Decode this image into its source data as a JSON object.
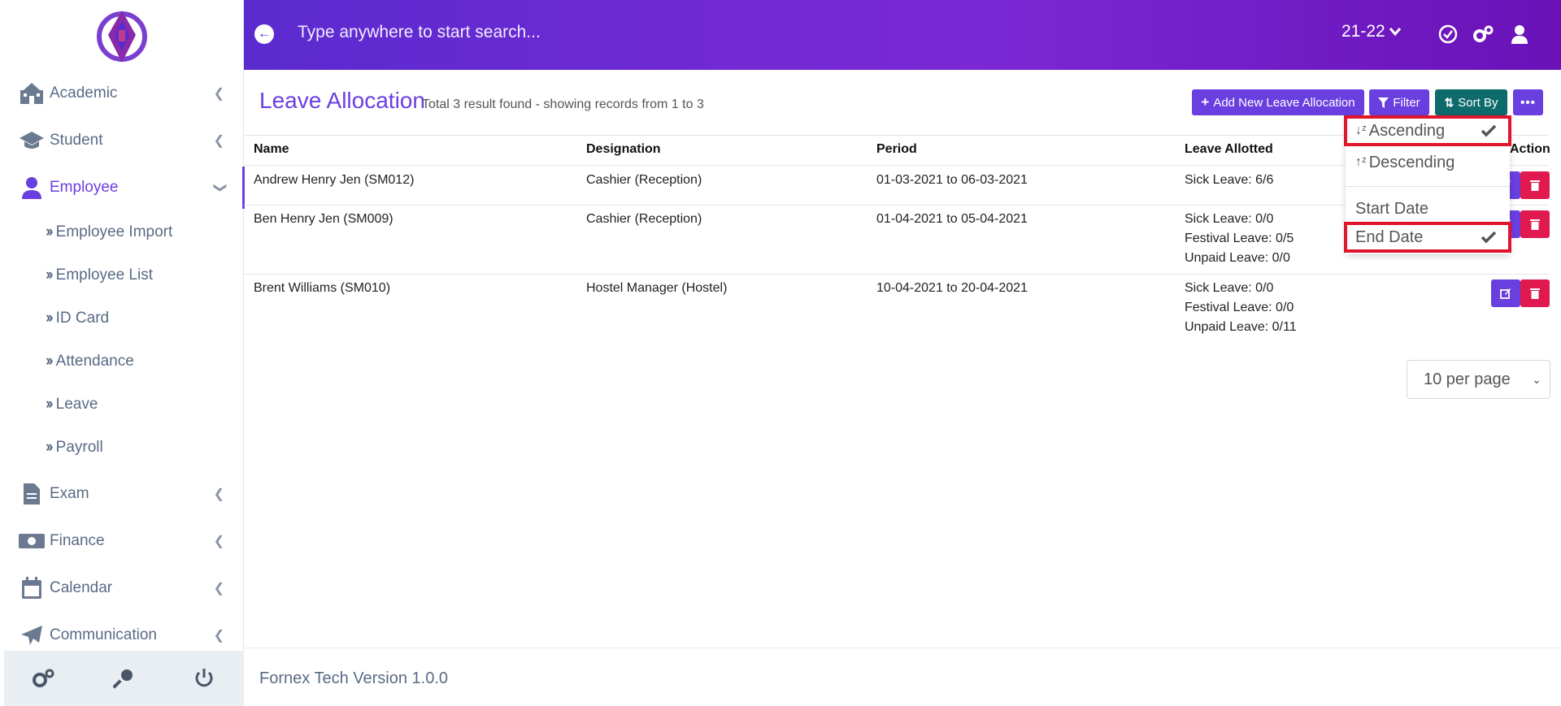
{
  "header": {
    "search_placeholder": "Type anywhere to start search...",
    "year": "21-22"
  },
  "sidebar": {
    "items": [
      {
        "label": "Academic"
      },
      {
        "label": "Student"
      },
      {
        "label": "Employee"
      },
      {
        "label": "Exam"
      },
      {
        "label": "Finance"
      },
      {
        "label": "Calendar"
      },
      {
        "label": "Communication"
      }
    ],
    "employee_sub": [
      {
        "label": "Employee Import"
      },
      {
        "label": "Employee List"
      },
      {
        "label": "ID Card"
      },
      {
        "label": "Attendance"
      },
      {
        "label": "Leave"
      },
      {
        "label": "Payroll"
      }
    ]
  },
  "page": {
    "title": "Leave Allocation",
    "result_text": "Total 3 result found - showing records from 1 to 3",
    "add_button": "Add New Leave Allocation",
    "filter_button": "Filter",
    "sort_button": "Sort By"
  },
  "table": {
    "headers": [
      "Name",
      "Designation",
      "Period",
      "Leave Allotted",
      "Action"
    ],
    "rows": [
      {
        "name": "Andrew Henry Jen (SM012)",
        "designation": "Cashier (Reception)",
        "period": "01-03-2021 to 06-03-2021",
        "leaves": [
          "Sick Leave: 6/6"
        ]
      },
      {
        "name": "Ben Henry Jen (SM009)",
        "designation": "Cashier (Reception)",
        "period": "01-04-2021 to 05-04-2021",
        "leaves": [
          "Sick Leave: 0/0",
          "Festival Leave: 0/5",
          "Unpaid Leave: 0/0"
        ]
      },
      {
        "name": "Brent Williams (SM010)",
        "designation": "Hostel Manager (Hostel)",
        "period": "10-04-2021 to 20-04-2021",
        "leaves": [
          "Sick Leave: 0/0",
          "Festival Leave: 0/0",
          "Unpaid Leave: 0/11"
        ]
      }
    ]
  },
  "pagination": {
    "per_page": "10 per page"
  },
  "sort_menu": {
    "ascending": "Ascending",
    "descending": "Descending",
    "start_date": "Start Date",
    "end_date": "End Date"
  },
  "footer": {
    "version": "Fornex Tech Version 1.0.0"
  },
  "colors": {
    "accent": "#6a3fe0",
    "danger": "#e01a4f",
    "teal": "#0e6b6b",
    "highlight": "#e0142a"
  }
}
